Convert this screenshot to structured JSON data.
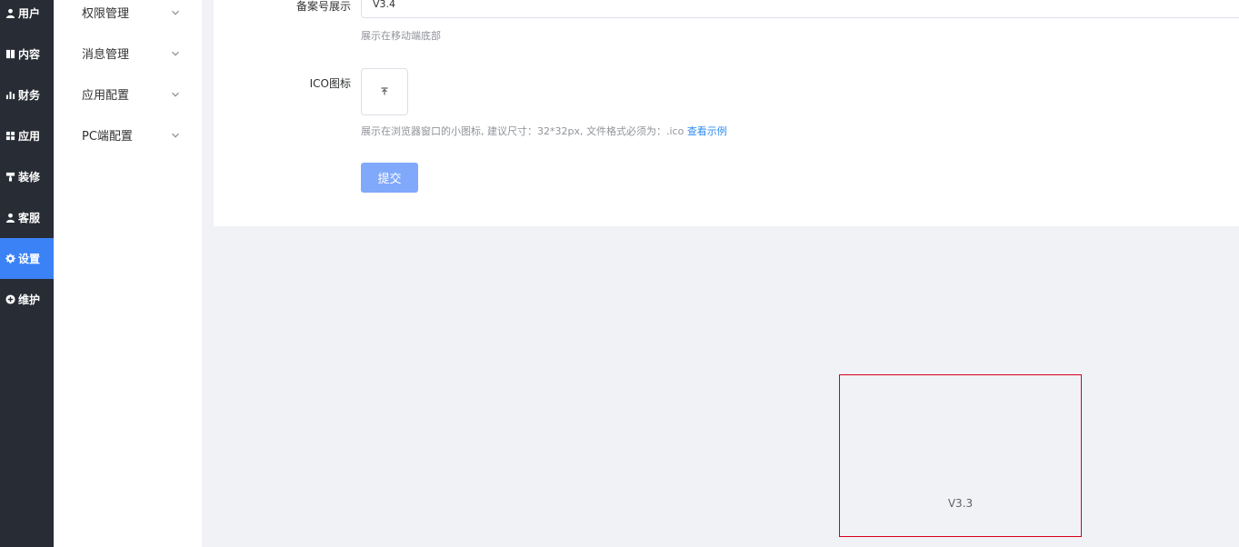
{
  "sidebar_primary": {
    "items": [
      {
        "label": "用户",
        "icon": "user-icon",
        "active": false
      },
      {
        "label": "内容",
        "icon": "book-icon",
        "active": false
      },
      {
        "label": "财务",
        "icon": "bar-chart-icon",
        "active": false
      },
      {
        "label": "应用",
        "icon": "grid-icon",
        "active": false
      },
      {
        "label": "装修",
        "icon": "paint-roller-icon",
        "active": false
      },
      {
        "label": "客服",
        "icon": "user-icon",
        "active": false
      },
      {
        "label": "设置",
        "icon": "gear-icon",
        "active": true
      },
      {
        "label": "维护",
        "icon": "circle-plus-icon",
        "active": false
      }
    ],
    "active_color": "#3b82f6"
  },
  "sidebar_secondary": {
    "items": [
      {
        "label": "权限管理"
      },
      {
        "label": "消息管理"
      },
      {
        "label": "应用配置"
      },
      {
        "label": "PC端配置"
      }
    ]
  },
  "form": {
    "record_label": "备案号展示",
    "record_value": "V3.4",
    "record_hint": "展示在移动端底部",
    "ico_label": "ICO图标",
    "ico_hint": "展示在浏览器窗口的小图标, 建议尺寸：32*32px, 文件格式必须为：.ico",
    "ico_hint_link": "查看示例",
    "submit_label": "提交"
  },
  "version_box": {
    "text": "V3.3",
    "border_color": "#d9001b"
  }
}
